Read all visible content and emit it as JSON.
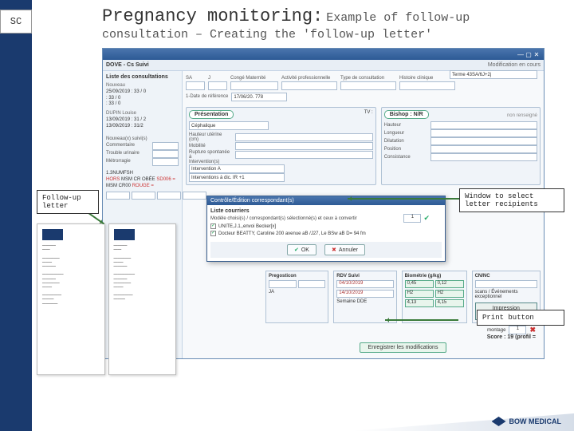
{
  "sc_label": "SC",
  "title": {
    "main": "Pregnancy monitoring:",
    "sub": "Example of follow-up",
    "line2": "consultation – Creating the 'follow-up letter'"
  },
  "callouts": {
    "followup": "Follow-up letter",
    "recipients": "Window to select letter recipients",
    "print": "Print button"
  },
  "app": {
    "titlebar": "",
    "patient_tab": "DOVE - Cs Suivi",
    "modif_label": "Modification en cours",
    "term_box": "Terme 43SA/6J+2j",
    "date_ref": "1-Date de référence",
    "date_val": "17/06/20. 778",
    "left": {
      "title": "Liste des consultations",
      "group1_lbl": "Nouveau",
      "g1_a": "25/09/2019 : 33 / 0",
      "g1_b": ": 33 / 0",
      "g1_c": ": 33 / 0",
      "group2_lbl": "DUPIN Louise",
      "g2_a": "13/09/2019 : 31 / 2",
      "g2_b": "13/09/2019 : 31/2",
      "labels": {
        "a": "Nouveau(x) suivi(s)",
        "b": "Commentaire",
        "c": "Trouble urinaire",
        "d": "Métrorragie"
      }
    },
    "top_row": {
      "sa": "SA",
      "j": "J",
      "conge": "Congé Maternité",
      "act": "Activité professionnelle",
      "type": "Type de consultation",
      "hist": "Histoire clinique"
    },
    "presentation": {
      "hdr": "Présentation",
      "p_tv": "TV :",
      "ceph": "Céphalique",
      "haut": "Hauteur utérine (cm)",
      "mob": "Mobilité",
      "rupt": "Rupture spontanée à",
      "interv": "Intervention(s)"
    },
    "bishop": {
      "hdr": "Bishop : N/R",
      "hauteur": "Hauteur",
      "longueur": "Longueur",
      "dilatation": "Dilatation",
      "position": "Position",
      "consist": "Consistance",
      "score": "non renseigné"
    },
    "blood": {
      "num": "1.3NUMFSH",
      "hors": "HORS",
      "msm": "MSM CR OBÉE",
      "sd006": "SD006 =",
      "id2": "MSM CR00",
      "rouge": "ROUGE ="
    },
    "interv": {
      "a": "Intervention A",
      "b": "Interventions à dic. IR +1"
    },
    "corresp": {
      "title": "Contrôle/Édition correspondant(s)",
      "header": "Modèle choisi(s) / correspondant(s) sélectionné(s) et ceux à convertir",
      "item1": "UNITE,J.1,,envoi Becker[x]",
      "item2": "Docteur BEATTY, Caroline 200 avenue aB /J27, Le BSw aB D= 94 fm",
      "ok": "OK",
      "cancel": "Annuler",
      "one": "1",
      "check": "✓"
    },
    "bottom": {
      "preg_lbl": "Pregosticon",
      "ja": "JA ",
      "rdv": "RDV Suivi",
      "date1": "04/10/2019",
      "date2": "14/10/2019",
      "sem": "Semaine DDE",
      "biom": "Biométrie (g/kg)",
      "b1": "0,45",
      "b2": "0,12",
      "b3": "4,13",
      "b4": "4,15",
      "b5": "H2",
      "b6": "H2",
      "cn": "CN/NC",
      "conc": "scans / Événements exceptionnel",
      "print": "Impression Courrier",
      "enr": "Enregistrer les modifications",
      "montage": "montage",
      "score_lbl": "Score :",
      "score_val": "19 (profil ="
    }
  },
  "footer_brand": "BOW MEDICAL"
}
